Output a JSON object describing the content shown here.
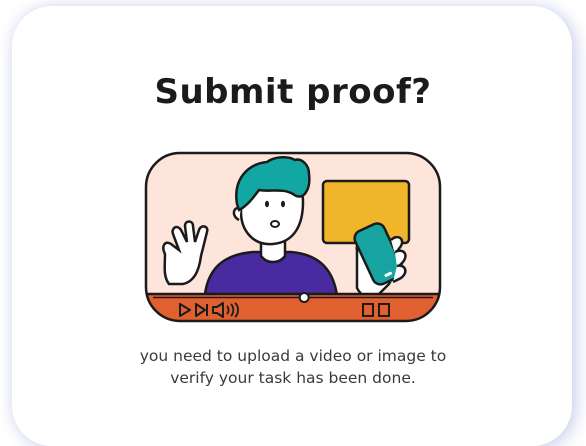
{
  "dialog": {
    "title": "Submit proof?",
    "description_line1": "you need to upload a video or image to",
    "description_line2": "verify your task has been done."
  },
  "illustration": {
    "icon": "video-upload-illustration",
    "colors": {
      "frame_bg": "#fde5dc",
      "control_bar": "#e0612f",
      "accent_box": "#f0b52a",
      "hair": "#12a7a3",
      "shirt": "#4a2aa0",
      "phone": "#17a3a0",
      "outline": "#1b1b1b"
    },
    "progress": 0.54
  }
}
